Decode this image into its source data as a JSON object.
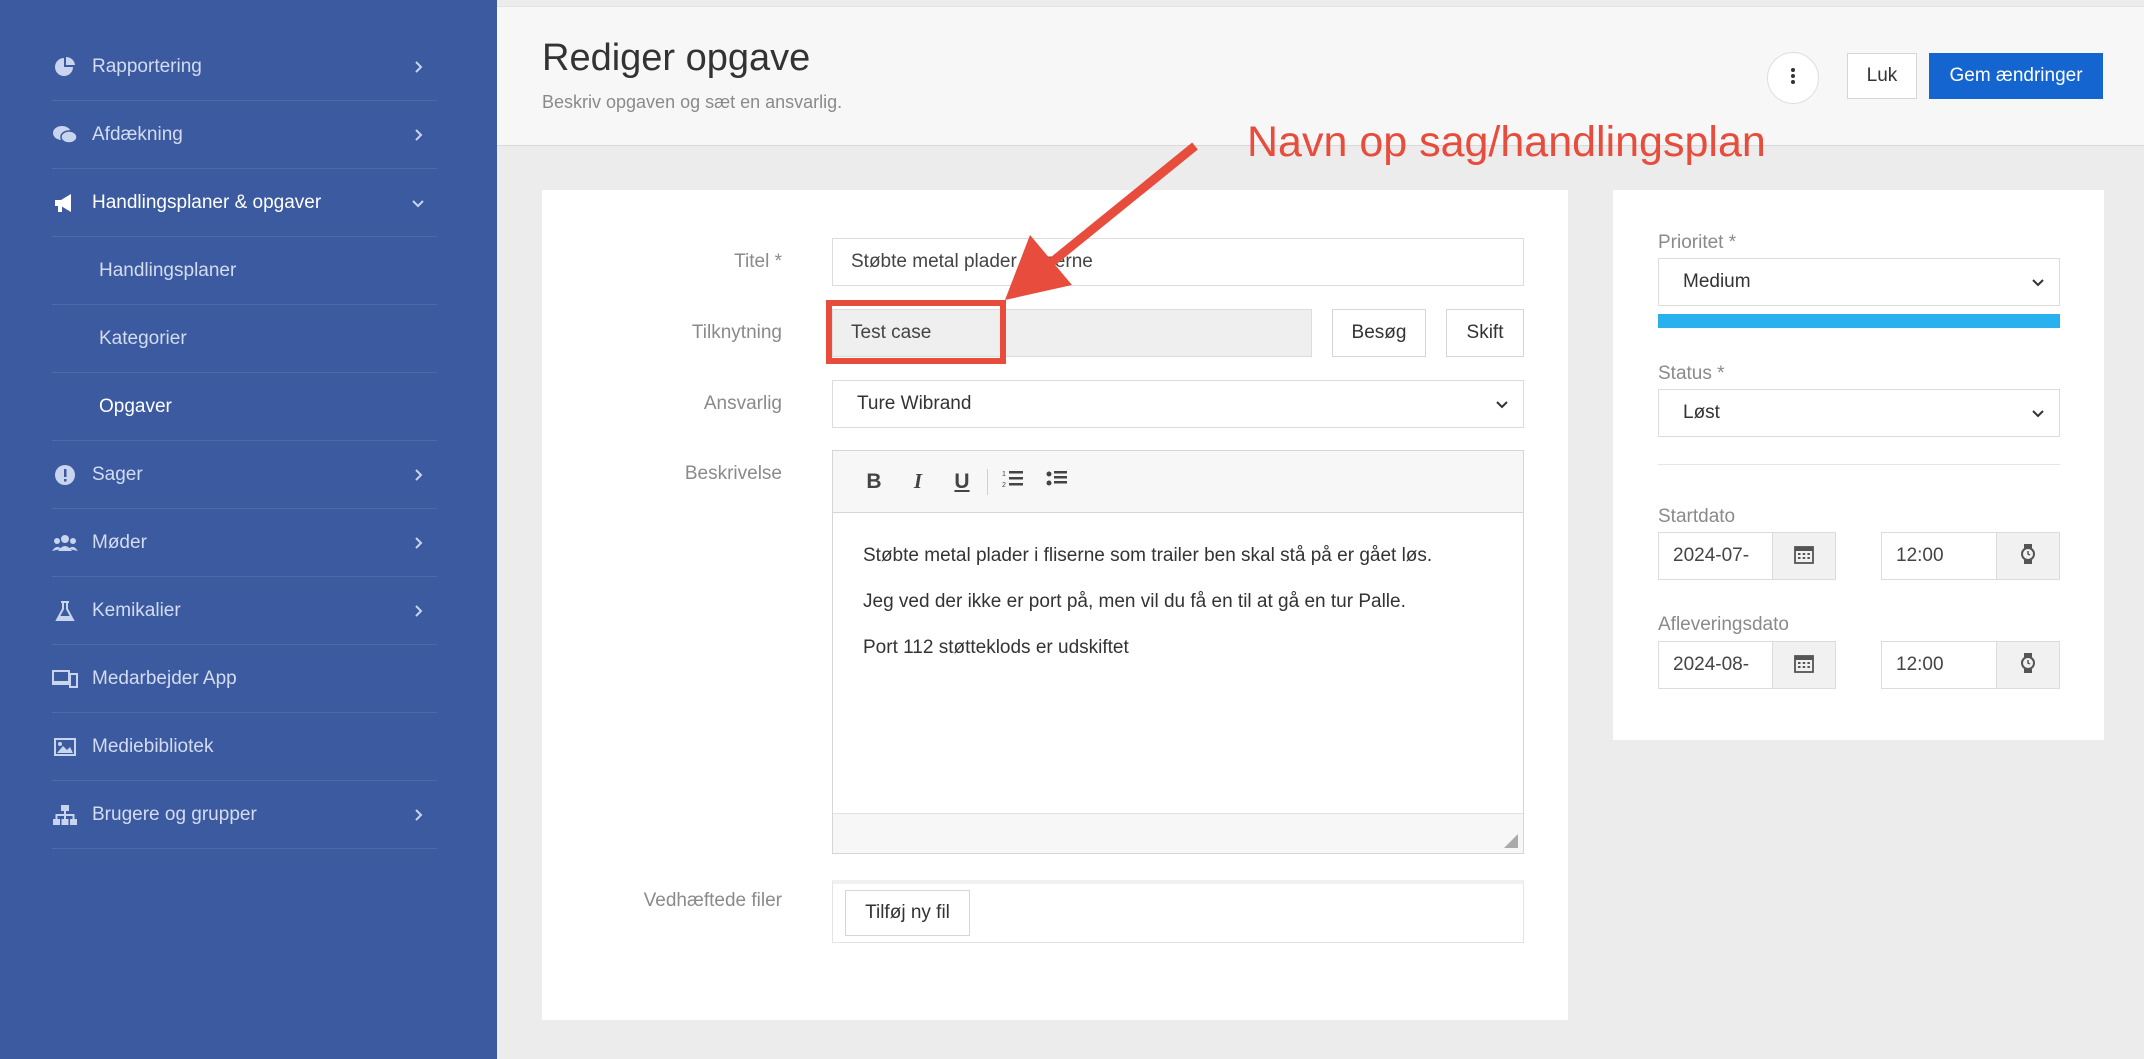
{
  "sidebar": {
    "items": [
      {
        "label": "Rapportering",
        "icon": "pie-chart-icon",
        "has_chevron": true
      },
      {
        "label": "Afdækning",
        "icon": "chat-bubbles-icon",
        "has_chevron": true
      },
      {
        "label": "Handlingsplaner & opgaver",
        "icon": "megaphone-icon",
        "has_chevron": true,
        "expanded": true
      },
      {
        "label": "Sager",
        "icon": "exclamation-icon",
        "has_chevron": true
      },
      {
        "label": "Møder",
        "icon": "users-icon",
        "has_chevron": true
      },
      {
        "label": "Kemikalier",
        "icon": "flask-icon",
        "has_chevron": true
      },
      {
        "label": "Medarbejder App",
        "icon": "devices-icon",
        "has_chevron": false
      },
      {
        "label": "Mediebibliotek",
        "icon": "image-icon",
        "has_chevron": false
      },
      {
        "label": "Brugere og grupper",
        "icon": "org-chart-icon",
        "has_chevron": true
      }
    ],
    "subitems": [
      {
        "label": "Handlingsplaner"
      },
      {
        "label": "Kategorier"
      },
      {
        "label": "Opgaver",
        "current": true
      }
    ]
  },
  "header": {
    "title": "Rediger opgave",
    "subtitle": "Beskriv opgaven og sæt en ansvarlig.",
    "close_label": "Luk",
    "save_label": "Gem ændringer"
  },
  "form": {
    "title_label": "Titel *",
    "title_value": "Støbte metal plader i fliserne",
    "link_label": "Tilknytning",
    "link_value": "Test case",
    "visit_label": "Besøg",
    "switch_label": "Skift",
    "responsible_label": "Ansvarlig",
    "responsible_value": "Ture Wibrand",
    "description_label": "Beskrivelse",
    "description_lines": [
      "Støbte metal plader i fliserne som trailer ben skal stå på er gået løs.",
      "Jeg ved der ikke er port på, men vil du få en til at gå en tur Palle.",
      "Port 112 støtteklods er udskiftet"
    ],
    "attachments_label": "Vedhæftede filer",
    "add_file_label": "Tilføj ny fil"
  },
  "side": {
    "priority_label": "Prioritet *",
    "priority_value": "Medium",
    "priority_level": 1.0,
    "priority_color": "#29b1ef",
    "status_label": "Status *",
    "status_value": "Løst",
    "start_label": "Startdato",
    "start_date": "2024-07-",
    "start_time": "12:00",
    "due_label": "Afleveringsdato",
    "due_date": "2024-08-",
    "due_time": "12:00"
  },
  "annotation": {
    "text": "Navn op sag/handlingsplan",
    "color": "#e74c3c"
  },
  "colors": {
    "sidebar_bg": "#3c5aa0",
    "primary": "#1565d1"
  }
}
